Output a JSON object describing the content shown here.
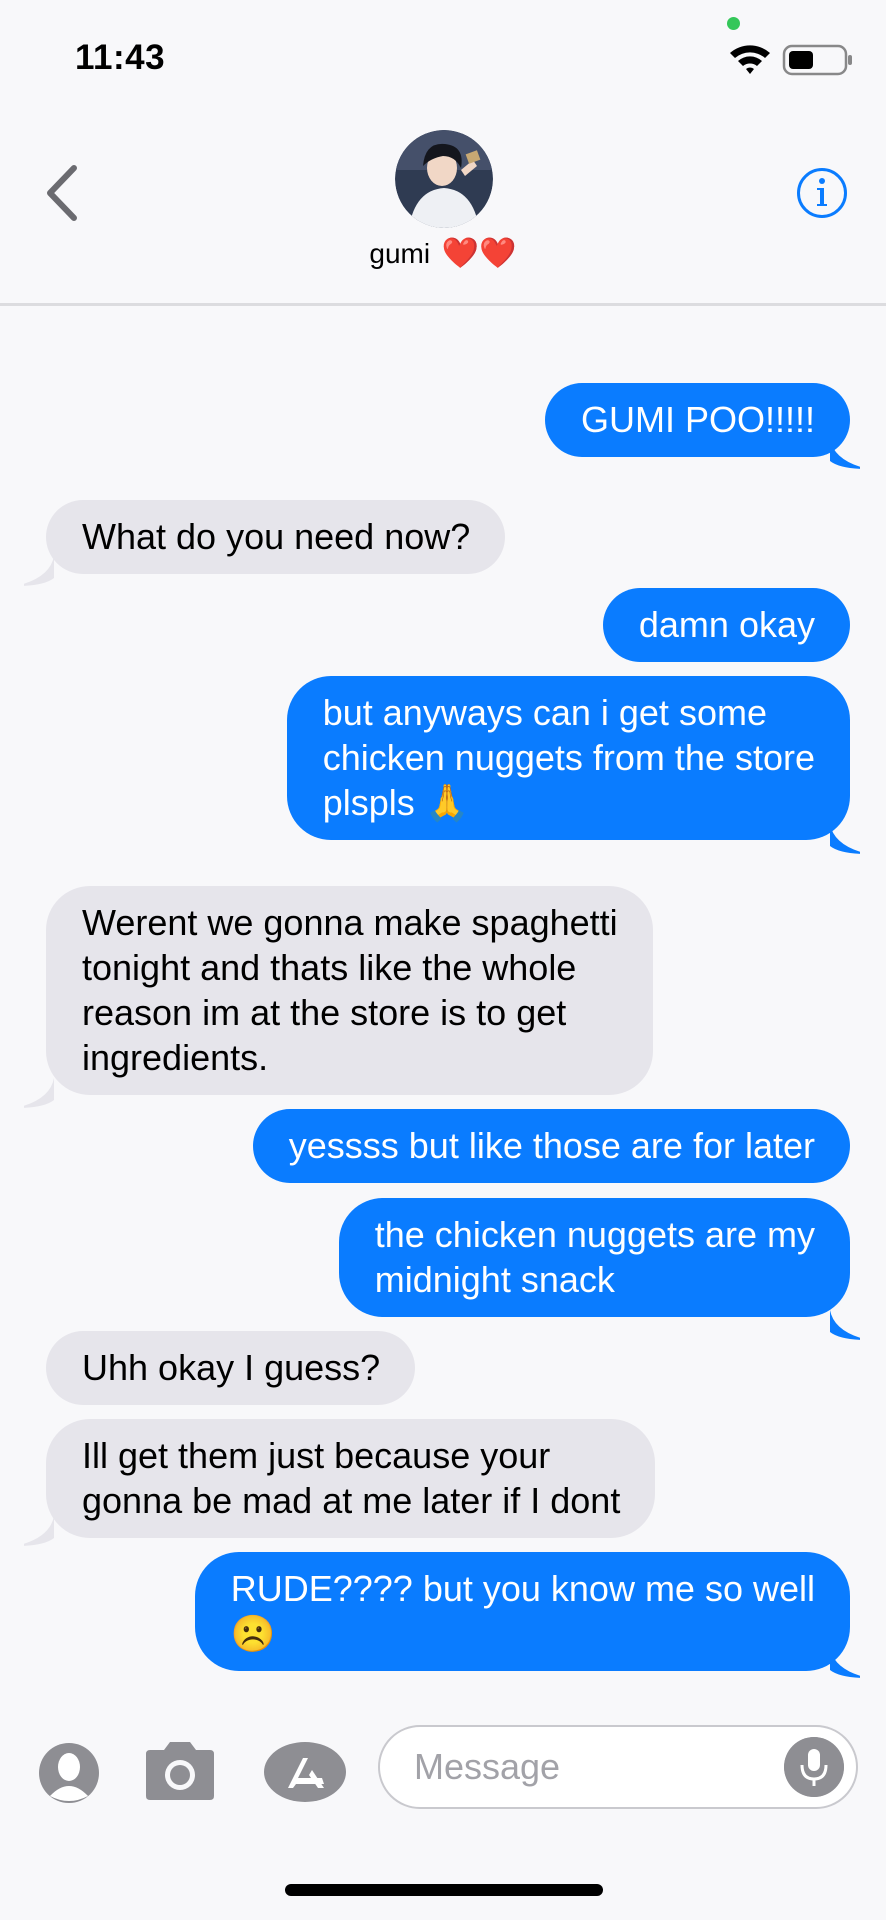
{
  "status_bar": {
    "time": "11:43",
    "icons": [
      "wifi-icon",
      "battery-icon"
    ],
    "camera_indicator_color": "#34c759"
  },
  "header": {
    "back_icon": "chevron-left-icon",
    "contact_name": "gumi",
    "contact_emoji": "❤️❤️",
    "info_icon": "info-icon"
  },
  "messages": [
    {
      "from": "me",
      "text": "GUMI POO!!!!!"
    },
    {
      "from": "them",
      "text": "What do you need now?"
    },
    {
      "from": "me",
      "text": "damn okay"
    },
    {
      "from": "me",
      "text": "but anyways can i get some\nchicken nuggets from the store\nplspls 🙏"
    },
    {
      "from": "them",
      "text": "Werent we gonna make spaghetti\ntonight and thats like the whole\nreason im at the store is to get\ningredients."
    },
    {
      "from": "me",
      "text": "yessss but like those are for later"
    },
    {
      "from": "me",
      "text": "the chicken nuggets are my\nmidnight snack"
    },
    {
      "from": "them",
      "text": "Uhh okay I guess?"
    },
    {
      "from": "them",
      "text": "Ill get them just because your\ngonna be mad at me later if I dont"
    },
    {
      "from": "me",
      "text": "RUDE???? but you know me so well\n☹️"
    }
  ],
  "compose": {
    "icons": [
      "memoji-icon",
      "camera-icon",
      "app-store-icon",
      "microphone-icon"
    ],
    "placeholder": "Message"
  },
  "colors": {
    "outgoing_bubble": "#0a7cff",
    "incoming_bubble": "#e6e5eb",
    "accent": "#0a7cff"
  }
}
